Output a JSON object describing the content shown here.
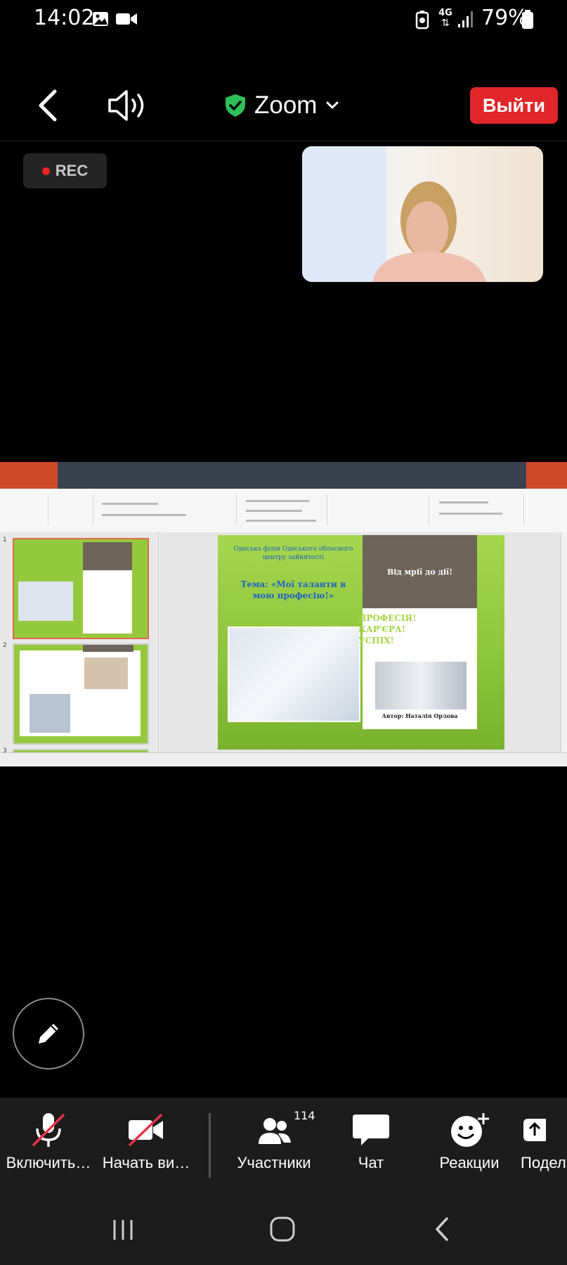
{
  "status_bar": {
    "time": "14:02",
    "network": "4G",
    "battery": "79%",
    "icons": [
      "gallery-icon",
      "video-icon",
      "battery-saver-icon",
      "signal-icon",
      "battery-icon"
    ]
  },
  "meeting_bar": {
    "app_title": "Zoom",
    "leave_label": "Выйти",
    "accent_color": "#e0262a",
    "shield_color": "#2fbf5a"
  },
  "recording": {
    "label": "REC"
  },
  "shared_slide": {
    "org_text": "Одеська філія Одеського обласного центру зайнятості",
    "topic": "Тема: «Мої таланти в мою професію!»",
    "slogan": "Від мрії до дії!",
    "profession_text": "ПРОФЕСІЯ! КАР'ЄРА! УСПІХ!",
    "author": "Автор: Наталія Орлова",
    "thumb_numbers": [
      "1",
      "2",
      "3"
    ]
  },
  "toolbar": {
    "unmute_label": "Включить…",
    "start_video_label": "Начать ви…",
    "participants_label": "Участники",
    "participants_count": "114",
    "chat_label": "Чат",
    "reactions_label": "Реакции",
    "share_label": "Подел"
  }
}
